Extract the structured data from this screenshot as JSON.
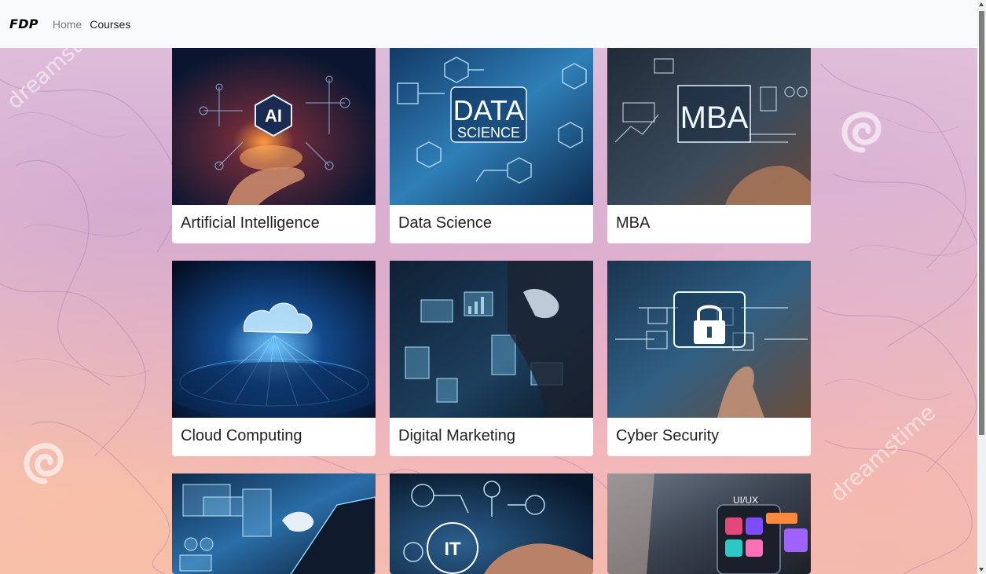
{
  "navbar": {
    "brand": "FDP",
    "links": [
      "Home",
      "Courses"
    ]
  },
  "background": {
    "watermark_text": "dreamstime"
  },
  "courses": [
    {
      "title": "Artificial Intelligence",
      "image_text": "AI",
      "icon": "ai-hand-image"
    },
    {
      "title": "Data Science",
      "image_text": "DATA",
      "image_subtext": "SCIENCE",
      "icon": "data-science-image"
    },
    {
      "title": "MBA",
      "image_text": "MBA",
      "icon": "mba-image"
    },
    {
      "title": "Cloud Computing",
      "image_text": "",
      "icon": "cloud-image"
    },
    {
      "title": "Digital Marketing",
      "image_text": "",
      "icon": "digital-marketing-image"
    },
    {
      "title": "Cyber Security",
      "image_text": "",
      "icon": "cyber-security-image"
    },
    {
      "title": "",
      "image_text": "",
      "icon": "robot-laptop-image"
    },
    {
      "title": "",
      "image_text": "IT",
      "icon": "it-touch-image"
    },
    {
      "title": "",
      "image_text": "UI/UX",
      "icon": "ui-ux-image"
    }
  ],
  "colors": {
    "navbar_bg": "#f8f9fa",
    "card_bg": "#ffffff",
    "image_dark_blue": "#0b2a4a",
    "accent_cyan": "#5fd0ff"
  }
}
